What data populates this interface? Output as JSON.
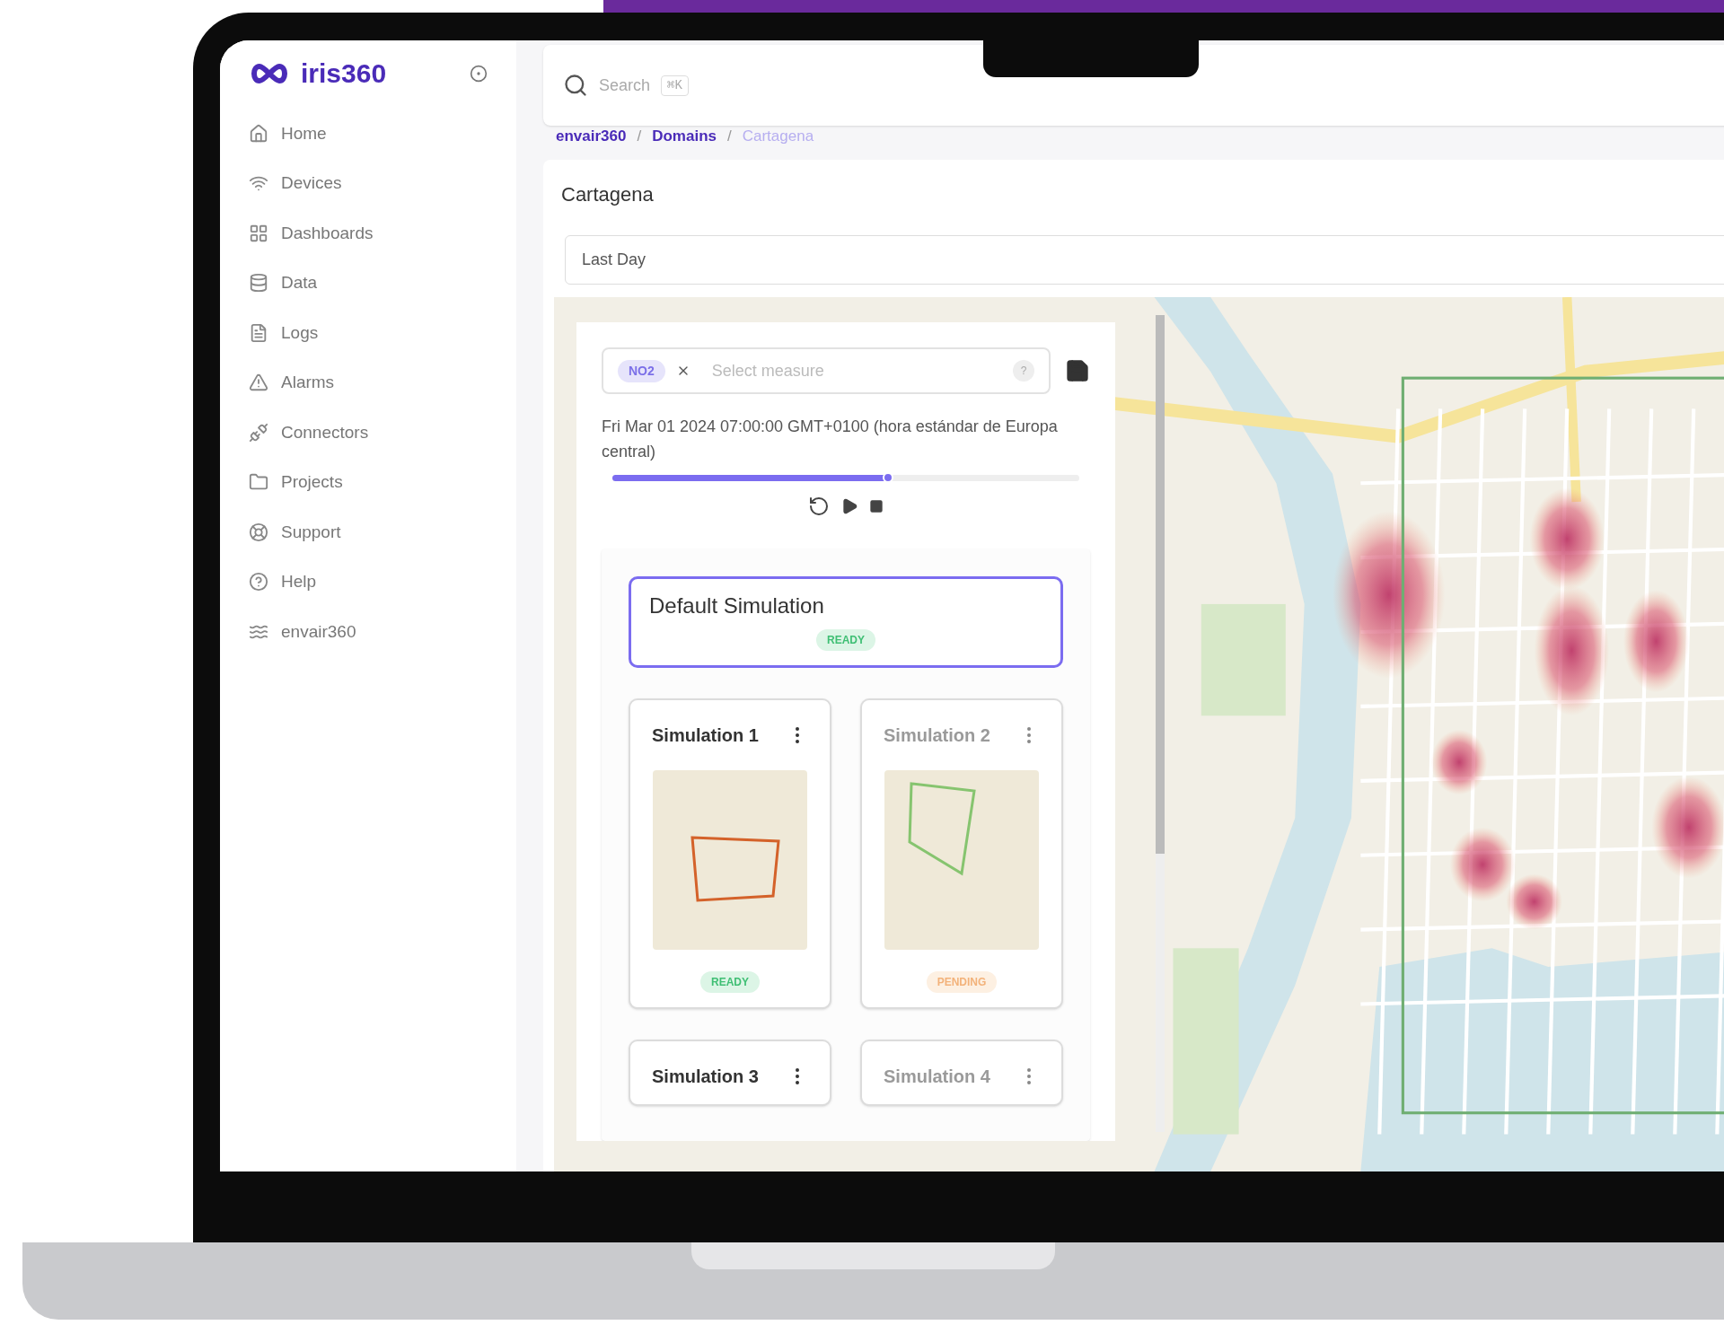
{
  "sidebar": {
    "logo": "iris360",
    "items": [
      {
        "label": "Home"
      },
      {
        "label": "Devices"
      },
      {
        "label": "Dashboards"
      },
      {
        "label": "Data"
      },
      {
        "label": "Logs"
      },
      {
        "label": "Alarms"
      },
      {
        "label": "Connectors"
      },
      {
        "label": "Projects"
      },
      {
        "label": "Support"
      },
      {
        "label": "Help"
      },
      {
        "label": "envair360"
      }
    ]
  },
  "search": {
    "placeholder": "Search",
    "shortcut": "⌘K"
  },
  "breadcrumb": [
    {
      "label": "envair360",
      "current": false
    },
    {
      "separator": "/",
      "label": "Domains",
      "current": false
    },
    {
      "separator": "/",
      "label": "Cartagena",
      "current": true
    }
  ],
  "page_title": "Cartagena",
  "period_field": {
    "value": "Last Day"
  },
  "measure_field": {
    "chip": "NO2",
    "placeholder": "Select measure",
    "count": "?"
  },
  "timestamp": "Fri Mar 01 2024 07:00:00 GMT+0100 (hora estándar de Europa central)",
  "timeline": {
    "level": 0.59
  },
  "default_simulation": {
    "name": "Default Simulation",
    "selected": true,
    "status": {
      "label": "READY",
      "kind": "ready"
    }
  },
  "simulations": [
    {
      "name": "Simulation 1",
      "disabled": false,
      "selected": false,
      "color": "#d4622a",
      "status": {
        "label": "READY",
        "kind": "ready"
      }
    },
    {
      "name": "Simulation 2",
      "disabled": true,
      "selected": false,
      "color": "#86c46f",
      "status": {
        "label": "PENDING",
        "kind": "pending"
      }
    },
    {
      "name": "Simulation 3",
      "disabled": false,
      "selected": false
    },
    {
      "name": "Simulation 4",
      "disabled": true,
      "selected": false
    }
  ]
}
